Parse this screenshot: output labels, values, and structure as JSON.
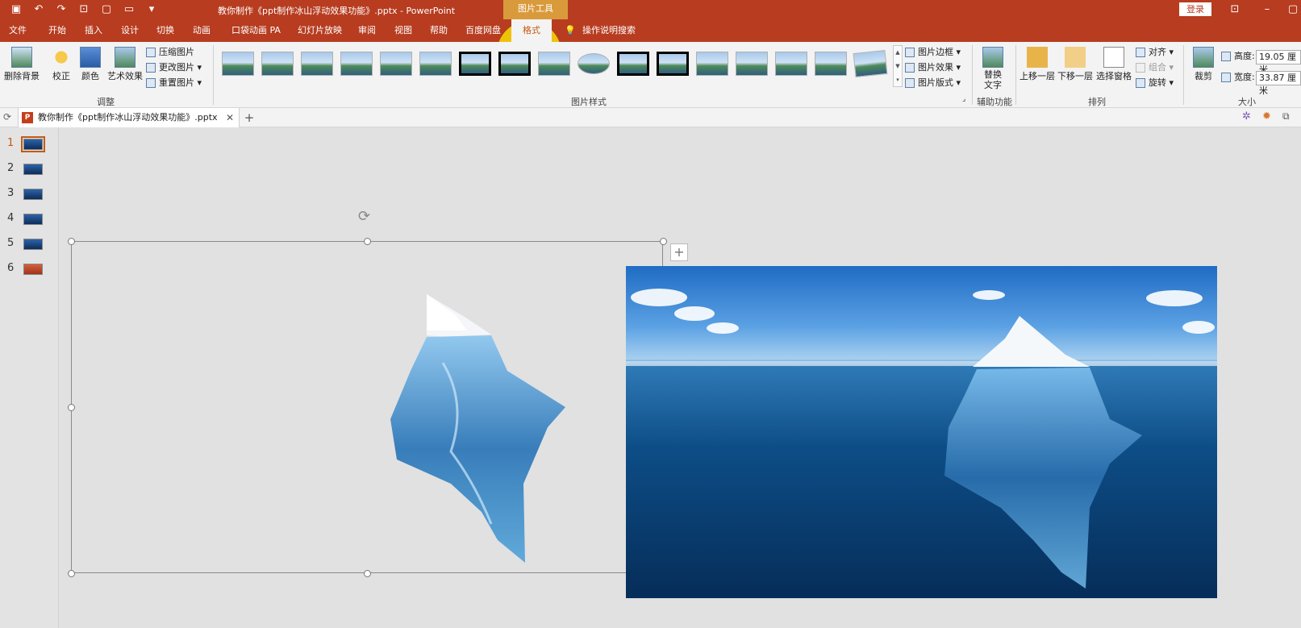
{
  "titlebar": {
    "doc_title": "教你制作《ppt制作冰山浮动效果功能》.pptx  -  PowerPoint",
    "context_tools": "图片工具",
    "login": "登录",
    "qat_icons": [
      "save-icon",
      "undo-icon",
      "redo-icon",
      "start-slideshow-icon",
      "new-file-icon",
      "open-folder-icon",
      "customize-qat-icon"
    ]
  },
  "tabs": [
    "文件",
    "开始",
    "插入",
    "设计",
    "切换",
    "动画",
    "口袋动画 PA",
    "幻灯片放映",
    "审阅",
    "视图",
    "帮助",
    "百度网盘",
    "格式",
    "操作说明搜索"
  ],
  "ribbon": {
    "remove_bg": "删除背景",
    "corrections": "校正",
    "color": "颜色",
    "artistic": "艺术效果",
    "compress": "压缩图片",
    "change": "更改图片",
    "reset": "重置图片",
    "adjust_group": "调整",
    "styles_group": "图片样式",
    "border": "图片边框",
    "effects": "图片效果",
    "layout": "图片版式",
    "alt_text": "替换文字",
    "accessibility_group": "辅助功能",
    "bring_forward": "上移一层",
    "send_backward": "下移一层",
    "selection_pane": "选择窗格",
    "align": "对齐",
    "group": "组合",
    "rotate": "旋转",
    "arrange_group": "排列",
    "crop": "裁剪",
    "height_label": "高度:",
    "height_value": "19.05 厘米",
    "width_label": "宽度:",
    "width_value": "33.87 厘米",
    "size_group": "大小"
  },
  "doc_tab": {
    "name": "教你制作《ppt制作冰山浮动效果功能》.pptx"
  },
  "slides": [
    "1",
    "2",
    "3",
    "4",
    "5",
    "6"
  ],
  "colors": {
    "accent": "#b73c20",
    "active_tab_text": "#c55a11",
    "context_tab": "#d99a3c"
  }
}
